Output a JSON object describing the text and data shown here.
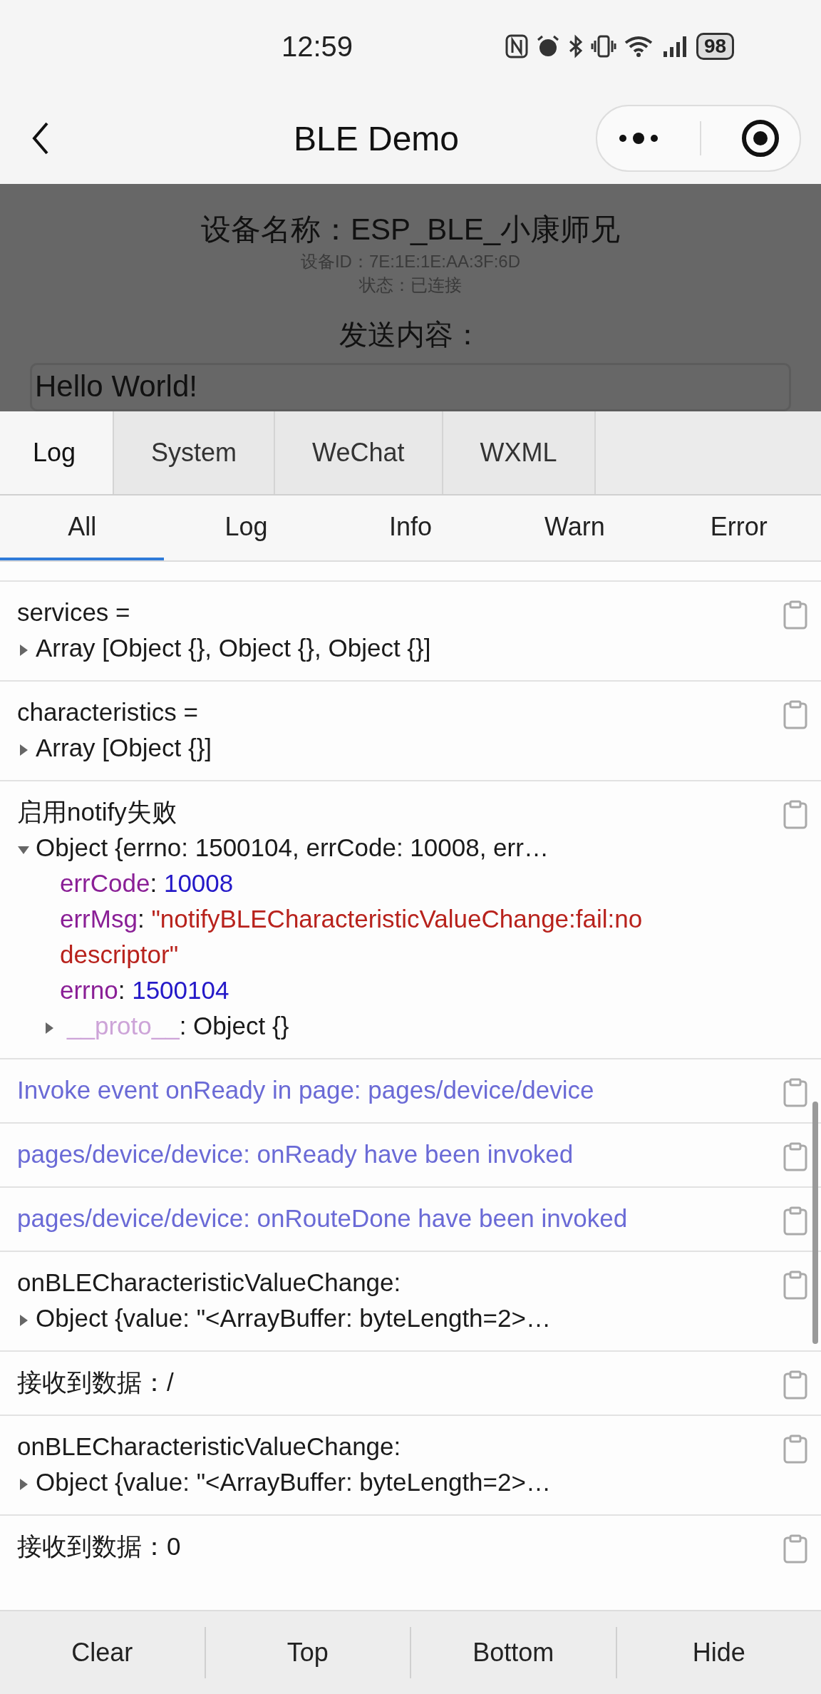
{
  "status_bar": {
    "time": "12:59",
    "battery": "98"
  },
  "nav": {
    "title": "BLE Demo"
  },
  "device": {
    "name": "设备名称：ESP_BLE_小康师兄",
    "id": "设备ID：7E:1E:1E:AA:3F:6D",
    "status": "状态：已连接",
    "send_label": "发送内容：",
    "send_value": "Hello World!"
  },
  "console": {
    "tabs": [
      {
        "label": "Log",
        "selected": true
      },
      {
        "label": "System",
        "selected": false
      },
      {
        "label": "WeChat",
        "selected": false
      },
      {
        "label": "WXML",
        "selected": false
      }
    ],
    "filters": [
      {
        "label": "All",
        "selected": true
      },
      {
        "label": "Log",
        "selected": false
      },
      {
        "label": "Info",
        "selected": false
      },
      {
        "label": "Warn",
        "selected": false
      },
      {
        "label": "Error",
        "selected": false
      }
    ],
    "entries": [
      {
        "kind": "log",
        "text": "services =",
        "value": {
          "summary": "Array [Object {}, Object {}, Object {}]",
          "expanded": false
        }
      },
      {
        "kind": "log",
        "text": "characteristics =",
        "value": {
          "summary": "Array [Object {}]",
          "expanded": false
        }
      },
      {
        "kind": "log",
        "text": "启用notify失败",
        "value": {
          "summary": "Object {errno: 1500104, errCode: 10008, err…",
          "expanded": true,
          "props": [
            {
              "key": "errCode",
              "sep": ":",
              "value": "10008",
              "kind": "number"
            },
            {
              "key": "errMsg",
              "sep": ":",
              "value": "\"notifyBLECharacteristicValueChange:fail:no descriptor\"",
              "kind": "string"
            },
            {
              "key": "errno",
              "sep": ":",
              "value": "1500104",
              "kind": "number"
            },
            {
              "key": "__proto__",
              "sep": ":",
              "value": "Object {}",
              "kind": "proto",
              "expanded": false
            }
          ]
        }
      },
      {
        "kind": "info",
        "text": "Invoke event onReady in page: pages/device/device"
      },
      {
        "kind": "info",
        "text": "pages/device/device: onReady have been invoked"
      },
      {
        "kind": "info",
        "text": "pages/device/device: onRouteDone have been invoked"
      },
      {
        "kind": "log",
        "text": "onBLECharacteristicValueChange:",
        "value": {
          "summary": "Object {value: \"<ArrayBuffer: byteLength=2>…",
          "expanded": false
        }
      },
      {
        "kind": "log",
        "text": "接收到数据：/"
      },
      {
        "kind": "log",
        "text": "onBLECharacteristicValueChange:",
        "value": {
          "summary": "Object {value: \"<ArrayBuffer: byteLength=2>…",
          "expanded": false
        }
      },
      {
        "kind": "log",
        "text": "接收到数据：0"
      }
    ]
  },
  "bottom_bar": {
    "buttons": [
      "Clear",
      "Top",
      "Bottom",
      "Hide"
    ]
  }
}
